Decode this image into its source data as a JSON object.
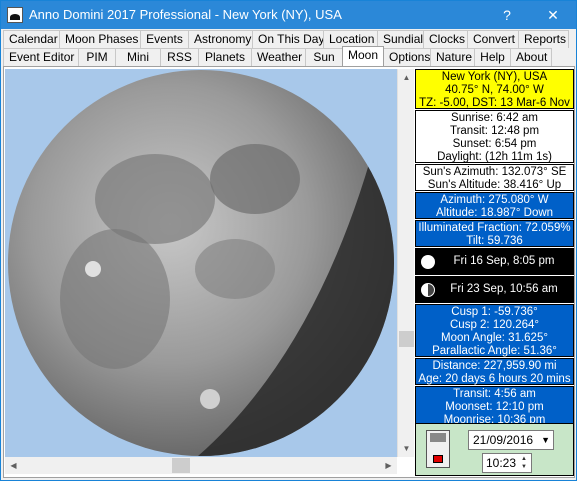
{
  "window": {
    "title": "Anno Domini 2017 Professional - New York (NY), USA",
    "help_label": "?",
    "close_label": "✕"
  },
  "tabs_row1": [
    "Calendar",
    "Moon Phases",
    "Events",
    "Astronomy",
    "On This Day",
    "Location",
    "Sundial",
    "Clocks",
    "Convert",
    "Reports"
  ],
  "tabs_row2": [
    "Event Editor",
    "PIM",
    "Mini",
    "RSS",
    "Planets",
    "Weather",
    "Sun",
    "Moon",
    "Options",
    "Nature",
    "Help",
    "About"
  ],
  "active_tab": "Moon",
  "location": {
    "name": "New York (NY), USA",
    "coords": "40.75° N, 74.00° W",
    "tz": "TZ: -5.00, DST: 13 Mar-6 Nov"
  },
  "sun_times": {
    "sunrise": "Sunrise: 6:42 am",
    "transit": "Transit: 12:48 pm",
    "sunset": "Sunset: 6:54 pm",
    "daylight": "Daylight: (12h 11m 1s)"
  },
  "sun_position": {
    "azimuth": "Sun's Azimuth: 132.073° SE",
    "altitude": "Sun's Altitude: 38.416° Up"
  },
  "moon_position": {
    "azimuth": "Azimuth: 275.080° W",
    "altitude": "Altitude: 18.987° Down"
  },
  "moon_illumination": {
    "fraction": "Illuminated Fraction: 72.059%",
    "tilt": "Tilt: 59.736"
  },
  "phases": [
    {
      "icon": "full-moon-icon",
      "label": "Fri 16 Sep, 8:05 pm"
    },
    {
      "icon": "last-quarter-icon",
      "label": "Fri 23 Sep, 10:56 am"
    }
  ],
  "moon_angles": {
    "cusp1": "Cusp 1: -59.736°",
    "cusp2": "Cusp 2: 120.264°",
    "moon_angle": "Moon Angle: 31.625°",
    "parallactic": "Parallactic Angle: 51.36°"
  },
  "moon_distance": {
    "distance": "Distance: 227,959.90 mi",
    "age": "Age: 20 days 6 hours 20 mins"
  },
  "moon_times": {
    "transit": "Transit: 4:56 am",
    "moonset": "Moonset: 12:10 pm",
    "moonrise": "Moonrise: 10:36 pm"
  },
  "date_picker": {
    "date": "21/09/2016",
    "time": "10:23"
  },
  "colors": {
    "titlebar": "#2b88d8",
    "panel_blue": "#0060c8",
    "panel_yellow": "#ffff00",
    "sky": "#a8c8ea",
    "bottom_panel": "#c8e6c8"
  }
}
